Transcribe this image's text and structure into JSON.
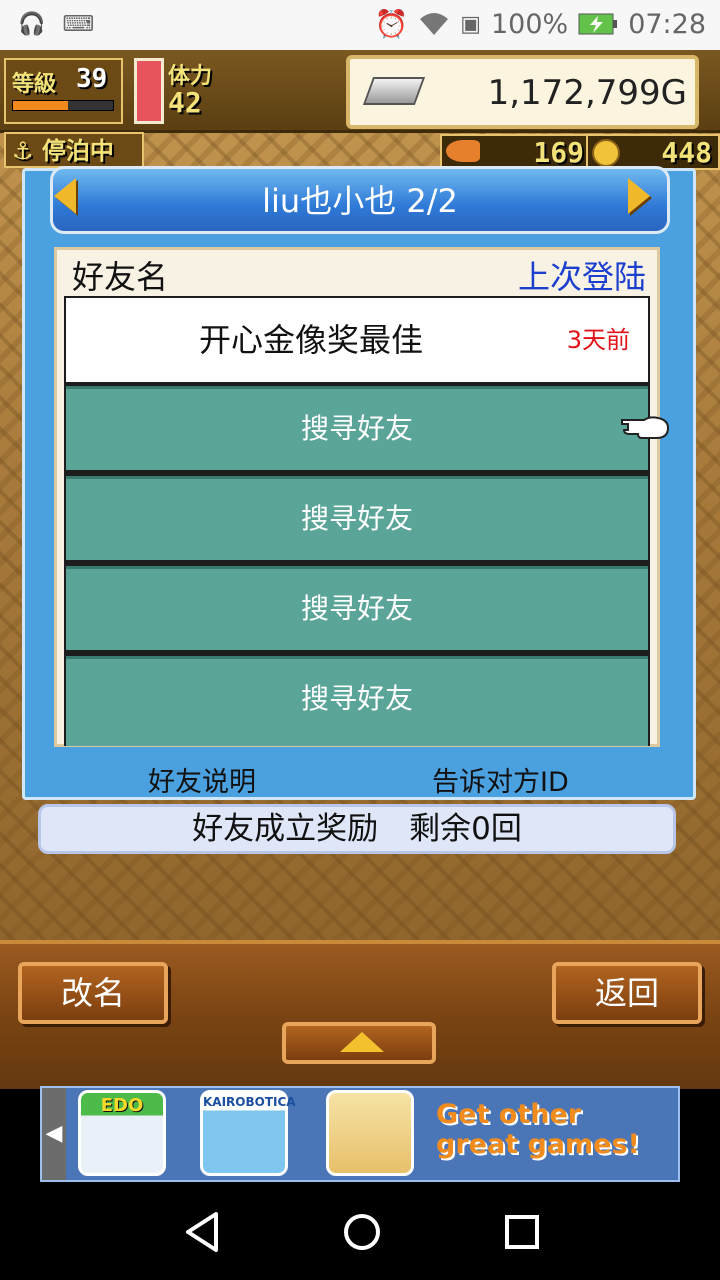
{
  "status_bar": {
    "battery": "100%",
    "time": "07:28",
    "icons": [
      "headset-icon",
      "keyboard-icon",
      "alarm-icon",
      "wifi-icon",
      "sim-icon",
      "battery-icon"
    ]
  },
  "hud": {
    "level_label": "等級",
    "level": "39",
    "level_progress": 0.55,
    "stamina_label": "体力",
    "stamina": "42",
    "money": "1,172,799G",
    "status_label": "停泊中",
    "fish_count": "169",
    "coin_count": "448"
  },
  "dialog": {
    "title": "liu也小也 2/2",
    "header_name": "好友名",
    "header_last_login": "上次登陆",
    "friend": {
      "name": "开心金像奖最佳",
      "last_login": "3天前"
    },
    "empty_slots": [
      "搜寻好友",
      "搜寻好友",
      "搜寻好友",
      "搜寻好友"
    ],
    "link_help": "好友说明",
    "link_tell_id": "告诉对方ID",
    "reward": "好友成立奖励　剩余0回"
  },
  "buttons": {
    "rename": "改名",
    "back": "返回"
  },
  "ad": {
    "edo_label": "EDO",
    "kairo_label": "KAIROBOTICA",
    "more_line1": "Get other",
    "more_line2": "great games!"
  },
  "colors": {
    "dialog_blue": "#4ba0df",
    "slot_teal": "#5aa598",
    "last_login_red": "#e0131a",
    "header_login_blue": "#1d3fd0"
  }
}
